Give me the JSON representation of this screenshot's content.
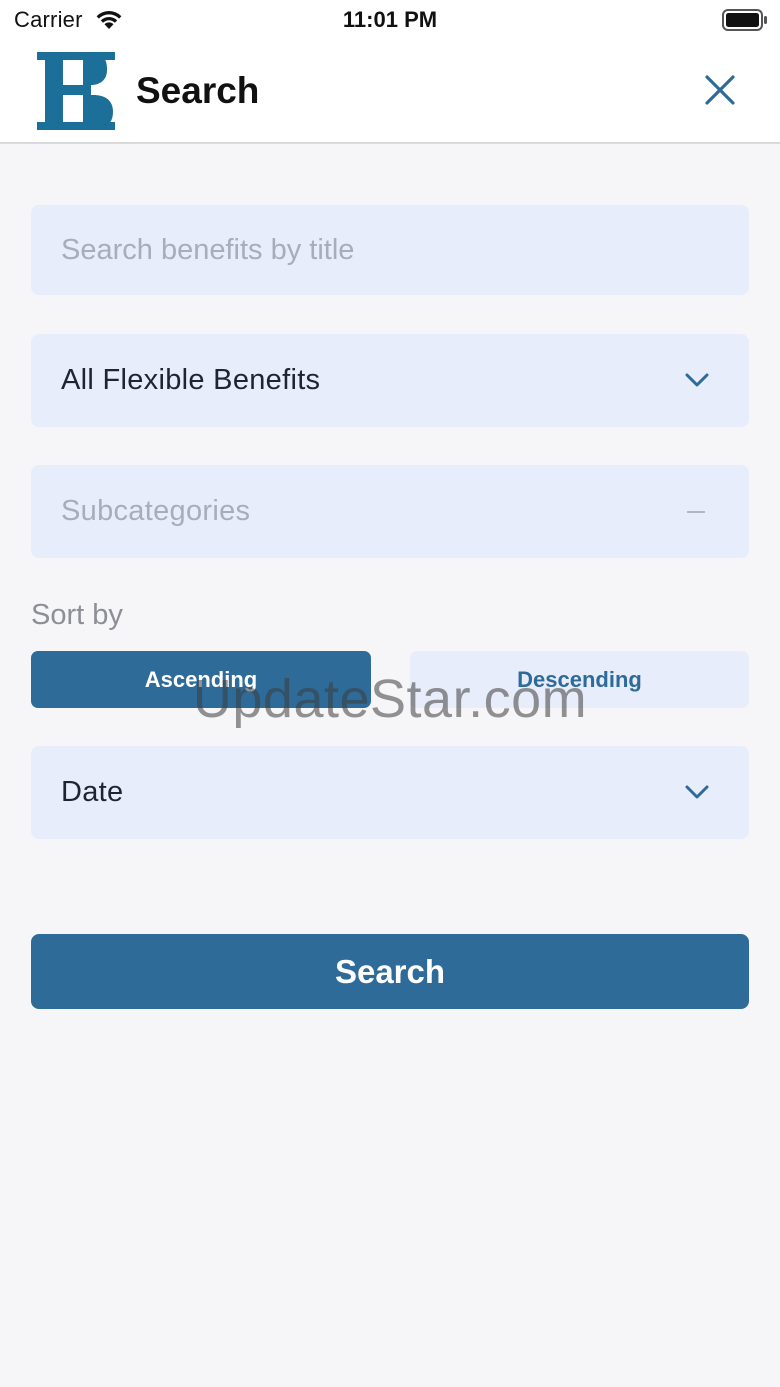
{
  "status_bar": {
    "carrier": "Carrier",
    "time": "11:01 PM"
  },
  "header": {
    "title": "Search",
    "logo_letter": "B"
  },
  "form": {
    "search_placeholder": "Search benefits by title",
    "category_value": "All Flexible Benefits",
    "subcategory_placeholder": "Subcategories",
    "sort_label": "Sort by",
    "sort_order": {
      "options": [
        "Ascending",
        "Descending"
      ],
      "selected": "Ascending"
    },
    "sort_field_value": "Date",
    "submit_label": "Search"
  },
  "watermark": "UpdateStar.com",
  "colors": {
    "accent": "#2e6b98",
    "field_bg": "#e8edfb",
    "page_bg": "#f6f5f7",
    "logo": "#1b6f99"
  },
  "icons": {
    "close": "close-icon",
    "chevron": "chevron-down-icon",
    "wifi": "wifi-icon",
    "battery": "battery-icon"
  }
}
